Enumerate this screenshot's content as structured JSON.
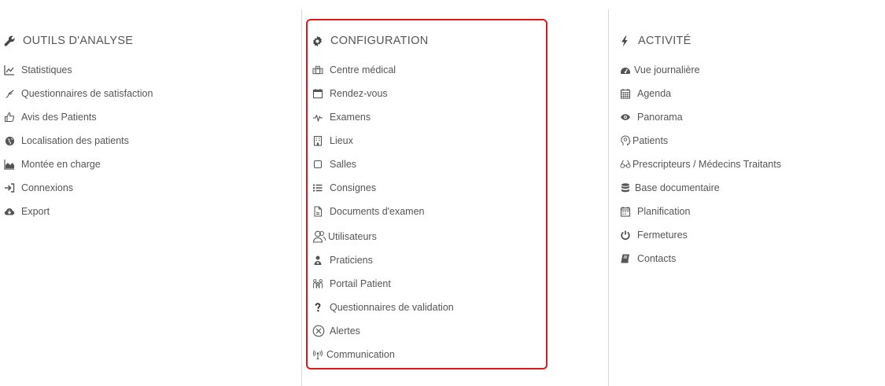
{
  "columns": {
    "analyse": {
      "title": "OUTILS D'ANALYSE",
      "title_icon": "wrench-icon",
      "items": [
        {
          "label": "Statistiques",
          "icon": "line-chart-icon"
        },
        {
          "label": "Questionnaires de satisfaction",
          "icon": "hand-point-icon"
        },
        {
          "label": "Avis des Patients",
          "icon": "thumbs-up-icon"
        },
        {
          "label": "Localisation des patients",
          "icon": "globe-icon"
        },
        {
          "label": "Montée en charge",
          "icon": "area-chart-icon"
        },
        {
          "label": "Connexions",
          "icon": "sign-in-icon"
        },
        {
          "label": "Export",
          "icon": "cloud-download-icon"
        }
      ]
    },
    "configuration": {
      "title": "CONFIGURATION",
      "title_icon": "gear-icon",
      "items": [
        {
          "label": "Centre médical",
          "icon": "hospital-icon"
        },
        {
          "label": "Rendez-vous",
          "icon": "calendar-icon"
        },
        {
          "label": "Examens",
          "icon": "heartbeat-icon"
        },
        {
          "label": "Lieux",
          "icon": "building-icon"
        },
        {
          "label": "Salles",
          "icon": "square-icon"
        },
        {
          "label": "Consignes",
          "icon": "list-icon"
        },
        {
          "label": "Documents d'examen",
          "icon": "file-icon"
        },
        {
          "label": "Utilisateurs",
          "icon": "users-icon"
        },
        {
          "label": "Praticiens",
          "icon": "user-md-icon"
        },
        {
          "label": "Portail Patient",
          "icon": "family-icon"
        },
        {
          "label": "Questionnaires de validation",
          "icon": "question-icon"
        },
        {
          "label": "Alertes",
          "icon": "alert-circle-icon"
        },
        {
          "label": "Communication",
          "icon": "broadcast-icon"
        }
      ]
    },
    "activite": {
      "title": "ACTIVITÉ",
      "title_icon": "bolt-icon",
      "items": [
        {
          "label": "Vue journalière",
          "icon": "dashboard-icon"
        },
        {
          "label": "Agenda",
          "icon": "calendar-grid-icon"
        },
        {
          "label": "Panorama",
          "icon": "eye-icon"
        },
        {
          "label": "Patients",
          "icon": "patient-head-icon"
        },
        {
          "label": "Prescripteurs / Médecins Traitants",
          "icon": "stethoscope-icon"
        },
        {
          "label": "Base documentaire",
          "icon": "database-icon"
        },
        {
          "label": "Planification",
          "icon": "calendar-plan-icon"
        },
        {
          "label": "Fermetures",
          "icon": "power-icon"
        },
        {
          "label": "Contacts",
          "icon": "book-icon"
        }
      ]
    }
  },
  "colors": {
    "text": "#555555",
    "divider": "#d8d8d8",
    "highlight": "#e01919"
  }
}
